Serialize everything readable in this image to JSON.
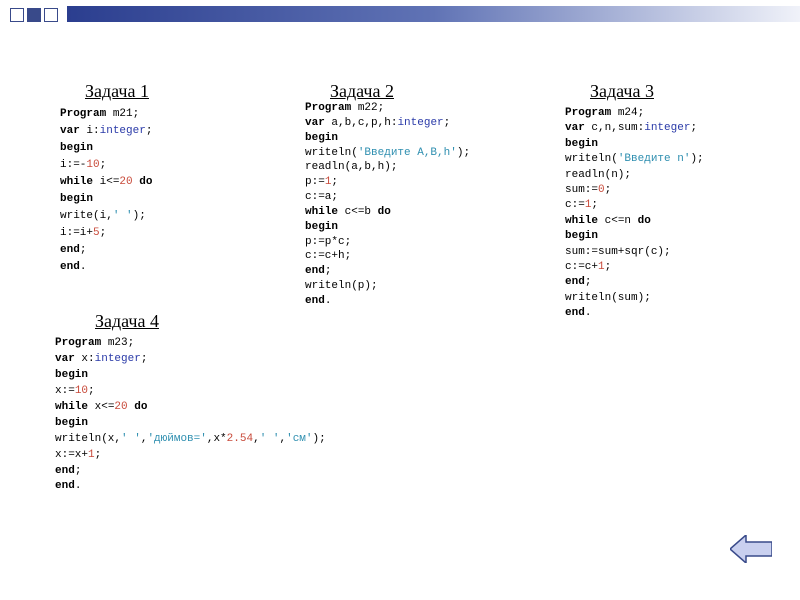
{
  "tasks": {
    "t1": {
      "title": "Задача 1"
    },
    "t2": {
      "title": "Задача 2"
    },
    "t3": {
      "title": "Задача 3"
    },
    "t4": {
      "title": "Задача 4"
    }
  },
  "code": {
    "t1": {
      "l1a": "Program",
      "l1b": " m21;",
      "l2a": "var",
      "l2b": " i:",
      "l2c": "integer",
      "l2d": ";",
      "l3": "begin",
      "l4a": "i:=-",
      "l4b": "10",
      "l4c": ";",
      "l5a": "while",
      "l5b": " i<=",
      "l5c": "20",
      "l5d": " ",
      "l5e": "do",
      "l6": "begin",
      "l7a": "write(i,",
      "l7b": "' '",
      "l7c": ");",
      "l8a": "i:=i+",
      "l8b": "5",
      "l8c": ";",
      "l9a": "end",
      "l9b": ";",
      "l10a": "end",
      "l10b": "."
    },
    "t2": {
      "l1a": "Program",
      "l1b": " m22;",
      "l2a": "var",
      "l2b": " a,b,c,p,h:",
      "l2c": "integer",
      "l2d": ";",
      "l3": "begin",
      "l4a": "writeln(",
      "l4b": "'Введите A,B,h'",
      "l4c": ");",
      "l5": "readln(a,b,h);",
      "l6a": "p:=",
      "l6b": "1",
      "l6c": ";",
      "l7": "c:=a;",
      "l8a": "while",
      "l8b": " c<=b ",
      "l8c": "do",
      "l9": "begin",
      "l10": "p:=p*c;",
      "l11": "c:=c+h;",
      "l12a": "end",
      "l12b": ";",
      "l13": "writeln(p);",
      "l14a": "end",
      "l14b": "."
    },
    "t3": {
      "l1a": "Program",
      "l1b": " m24;",
      "l2a": "var",
      "l2b": " c,n,sum:",
      "l2c": "integer",
      "l2d": ";",
      "l3": "begin",
      "l4a": "writeln(",
      "l4b": "'Введите n'",
      "l4c": ");",
      "l5": "readln(n);",
      "l6a": "sum:=",
      "l6b": "0",
      "l6c": ";",
      "l7a": "c:=",
      "l7b": "1",
      "l7c": ";",
      "l8a": "while",
      "l8b": " c<=n ",
      "l8c": "do",
      "l9": "begin",
      "l10": "sum:=sum+sqr(c);",
      "l11a": "c:=c+",
      "l11b": "1",
      "l11c": ";",
      "l12a": "end",
      "l12b": ";",
      "l13": "writeln(sum);",
      "l14a": "end",
      "l14b": "."
    },
    "t4": {
      "l1a": "Program",
      "l1b": " m23;",
      "l2a": "var",
      "l2b": " x:",
      "l2c": "integer",
      "l2d": ";",
      "l3": "begin",
      "l4a": "x:=",
      "l4b": "10",
      "l4c": ";",
      "l5a": "while",
      "l5b": " x<=",
      "l5c": "20",
      "l5d": " ",
      "l5e": "do",
      "l6": "begin",
      "l7a": "writeln(x,",
      "l7b": "' '",
      "l7c": ",",
      "l7d": "'дюймов='",
      "l7e": ",x*",
      "l7f": "2.54",
      "l7g": ",",
      "l7h": "' '",
      "l7i": ",",
      "l7j": "'см'",
      "l7k": ");",
      "l8a": "x:=x+",
      "l8b": "1",
      "l8c": ";",
      "l9a": "end",
      "l9b": ";",
      "l10a": "end",
      "l10b": "."
    }
  },
  "nav": {
    "back": "back"
  }
}
